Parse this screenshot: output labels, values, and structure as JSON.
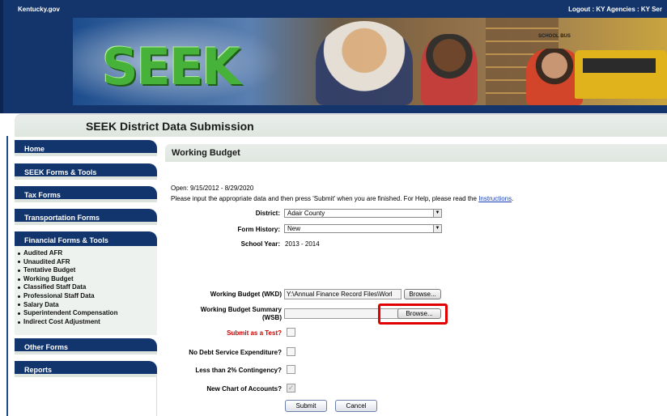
{
  "header": {
    "site": "Kentucky.gov",
    "top_right": "Logout : KY Agencies : KY Ser",
    "logo_text": "SEEK",
    "bus_label": "SCHOOL BUS"
  },
  "title": "SEEK District Data Submission",
  "sidebar": {
    "items": [
      {
        "label": "Home"
      },
      {
        "label": "SEEK Forms & Tools"
      },
      {
        "label": "Tax Forms"
      },
      {
        "label": "Transportation Forms"
      },
      {
        "label": "Financial Forms & Tools"
      },
      {
        "label": "Other Forms"
      },
      {
        "label": "Reports"
      }
    ],
    "financial_sub": [
      "Audited AFR",
      "Unaudited AFR",
      "Tentative Budget",
      "Working Budget",
      "Classified Staff Data",
      "Professional Staff Data",
      "Salary Data",
      "Superintendent Compensation",
      "Indirect Cost Adjustment"
    ]
  },
  "main": {
    "heading": "Working Budget",
    "open_text": "Open: 9/15/2012 - 8/29/2020",
    "instructions_text": "Please input the appropriate data and then press 'Submit' when you are finished. For Help, please read the",
    "instructions_link": "Instructions",
    "instructions_end": ".",
    "district_label": "District:",
    "district_value": "Adair County",
    "form_history_label": "Form History:",
    "form_history_value": "New",
    "school_year_label": "School Year:",
    "school_year_value": "2013 - 2014",
    "wkd_label": "Working Budget (WKD)",
    "wkd_value": "Y:\\Annual Finance Record Files\\Worl",
    "wsb_label_1": "Working Budget Summary",
    "wsb_label_2": "(WSB)",
    "wsb_value": "",
    "browse_label": "Browse...",
    "submit_test_label": "Submit as a Test?",
    "no_debt_label": "No Debt Service Expenditure?",
    "contingency_label": "Less than 2% Contingency?",
    "chart_accounts_label": "New Chart of Accounts?",
    "chart_accounts_checked": true,
    "submit_label": "Submit",
    "cancel_label": "Cancel"
  },
  "colors": {
    "nav": "#12356d",
    "highlight": "#e00000",
    "link": "#1a3fb0",
    "logo": "#46b23a"
  }
}
